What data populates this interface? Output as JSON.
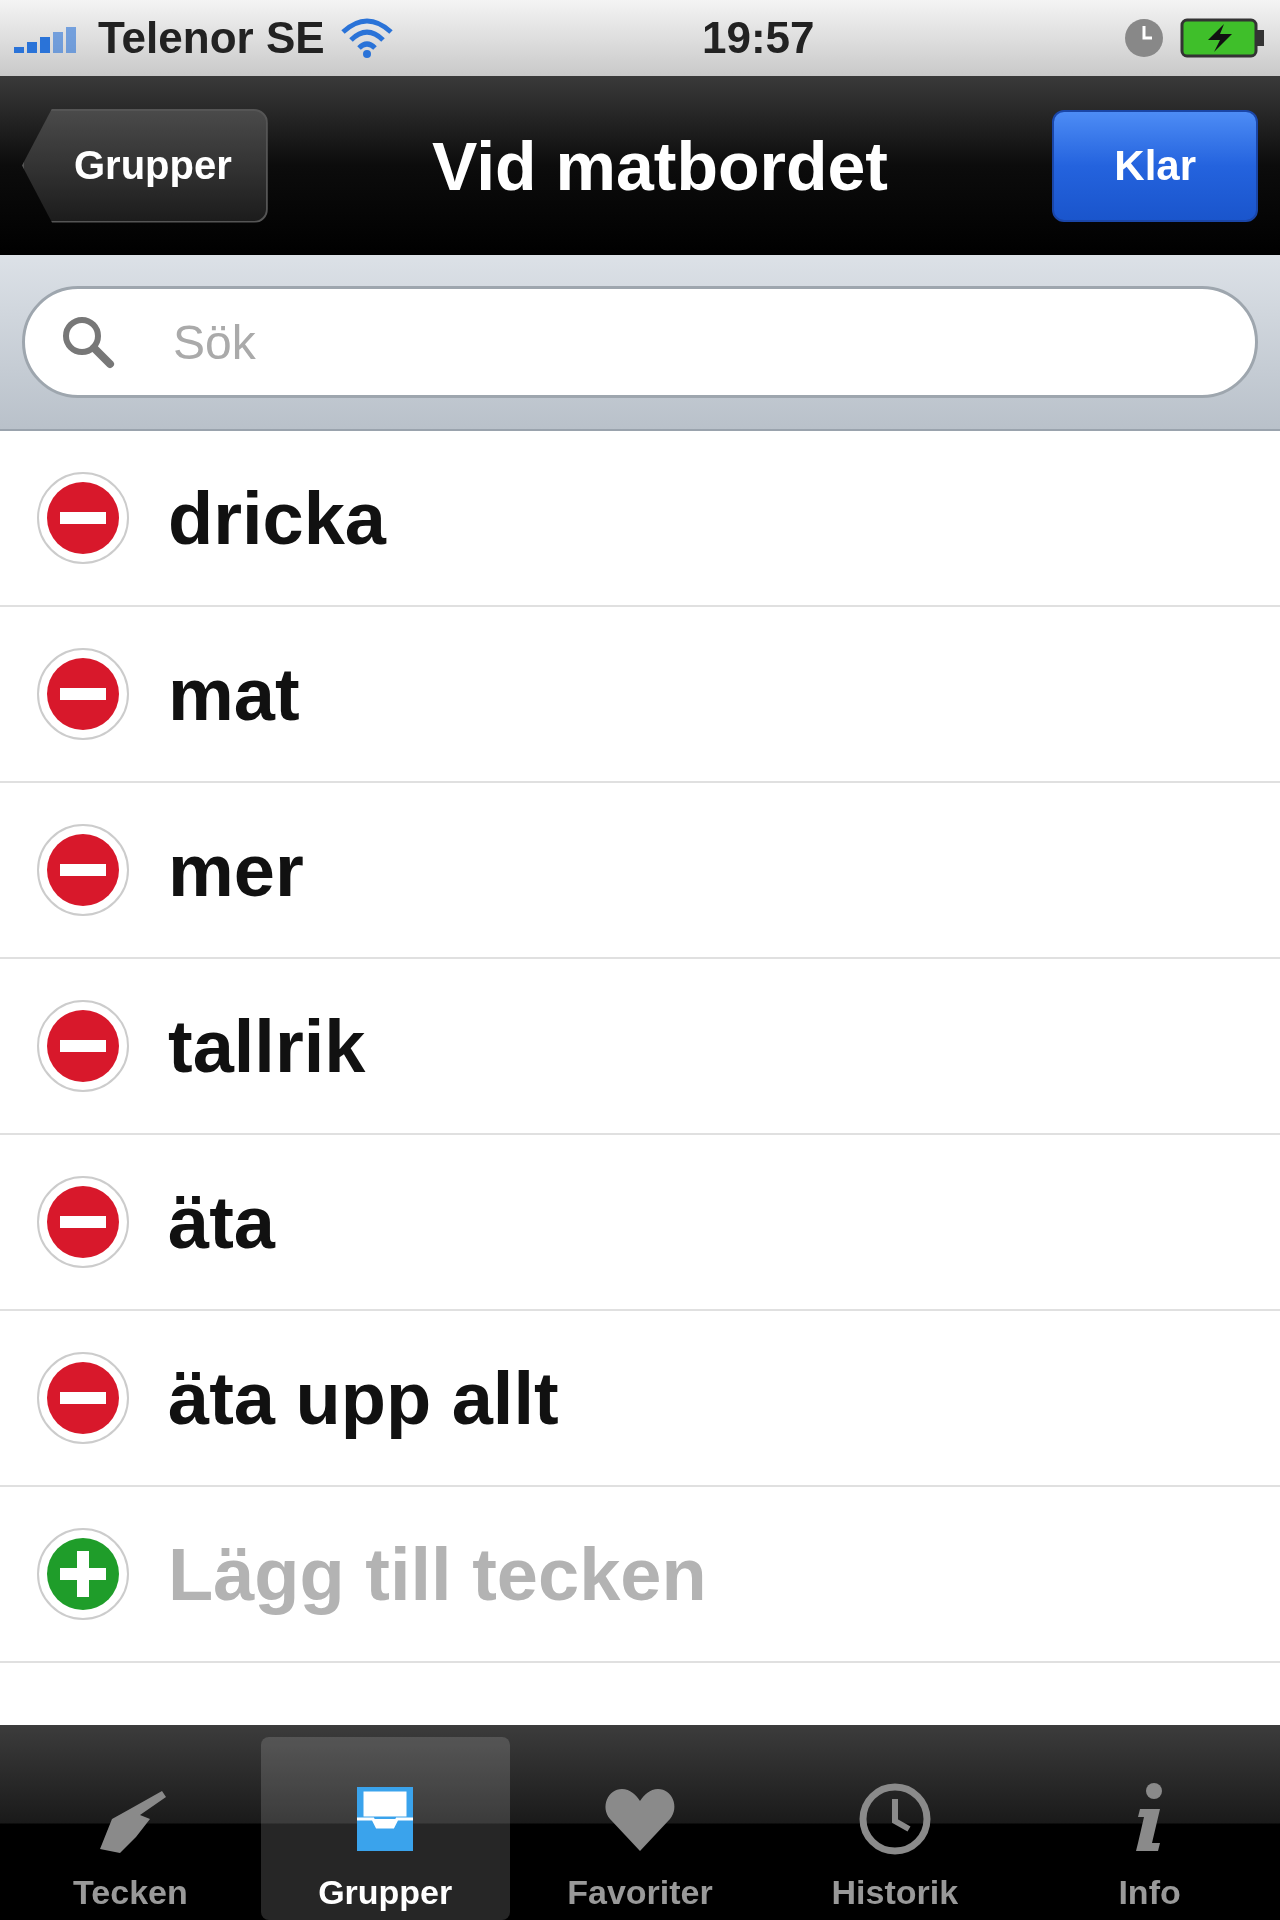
{
  "status_bar": {
    "carrier": "Telenor SE",
    "time": "19:57"
  },
  "nav_bar": {
    "back": "Grupper",
    "title": "Vid matbordet",
    "done": "Klar"
  },
  "search": {
    "placeholder": "Sök"
  },
  "rows": [
    {
      "kind": "remove",
      "label": "dricka"
    },
    {
      "kind": "remove",
      "label": "mat"
    },
    {
      "kind": "remove",
      "label": "mer"
    },
    {
      "kind": "remove",
      "label": "tallrik"
    },
    {
      "kind": "remove",
      "label": "äta"
    },
    {
      "kind": "remove",
      "label": "äta upp allt"
    },
    {
      "kind": "add",
      "label": "Lägg till tecken"
    }
  ],
  "tabs": [
    {
      "kind": "hand",
      "label": "Tecken",
      "selected": false
    },
    {
      "kind": "tray",
      "label": "Grupper",
      "selected": true
    },
    {
      "kind": "heart",
      "label": "Favoriter",
      "selected": false
    },
    {
      "kind": "clock",
      "label": "Historik",
      "selected": false
    },
    {
      "kind": "info",
      "label": "Info",
      "selected": false
    }
  ]
}
